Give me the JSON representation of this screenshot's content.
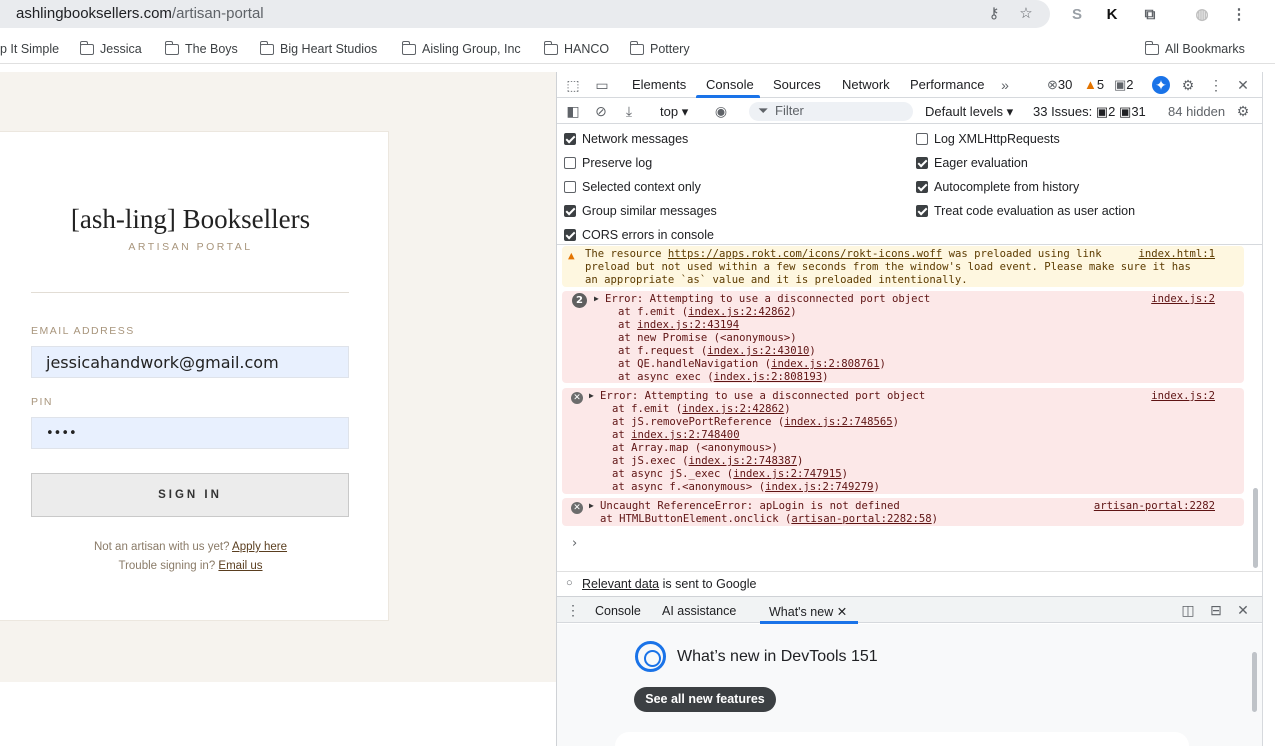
{
  "browser": {
    "url_host": "ashlingbooksellers.com",
    "url_path": "/artisan-portal",
    "bookmarks": [
      "p It Simple",
      "Jessica",
      "The Boys",
      "Big Heart Studios",
      "Aisling Group, Inc",
      "HANCO",
      "Pottery"
    ],
    "all_bookmarks": "All Bookmarks",
    "extensions": [
      "S",
      "K"
    ]
  },
  "login": {
    "brand": "[ash-ling] Booksellers",
    "subbrand": "ARTISAN PORTAL",
    "email_label": "EMAIL ADDRESS",
    "email_value": "jessicahandwork@gmail.com",
    "pin_label": "PIN",
    "pin_value": "••••",
    "signin_label": "SIGN IN",
    "not_artisan": "Not an artisan with us yet?",
    "apply_link": "Apply here",
    "trouble": "Trouble signing in?",
    "email_link": "Email us"
  },
  "devtools": {
    "tabs": [
      "Elements",
      "Console",
      "Sources",
      "Network",
      "Performance"
    ],
    "active_tab": "Console",
    "errors_count": "30",
    "warnings_count": "5",
    "info_count": "2",
    "context": "top",
    "filter_placeholder": "Filter",
    "levels": "Default levels",
    "issues_label": "33 Issues:",
    "issues_a": "2",
    "issues_b": "31",
    "hidden": "84 hidden",
    "settings": {
      "left": [
        {
          "label": "Network messages",
          "checked": true
        },
        {
          "label": "Preserve log",
          "checked": false
        },
        {
          "label": "Selected context only",
          "checked": false
        },
        {
          "label": "Group similar messages",
          "checked": true
        },
        {
          "label": "CORS errors in console",
          "checked": true
        }
      ],
      "right": [
        {
          "label": "Log XMLHttpRequests",
          "checked": false
        },
        {
          "label": "Eager evaluation",
          "checked": true
        },
        {
          "label": "Autocomplete from history",
          "checked": true
        },
        {
          "label": "Treat code evaluation as user action",
          "checked": true
        }
      ]
    },
    "warning": {
      "prefix": "The resource ",
      "link": "https://apps.rokt.com/icons/rokt-icons.woff",
      "rest1": " was preloaded using link",
      "line2": "preload but not used within a few seconds from the window's load event. Please make sure it has",
      "line3": "an appropriate `as` value and it is preloaded intentionally.",
      "source": "index.html:1"
    },
    "error1": {
      "count": "2",
      "title": "Error: Attempting to use a disconnected port object",
      "source": "index.js:2",
      "stack": [
        [
          "at f.emit (",
          "index.js:2:42862",
          ")"
        ],
        [
          "at ",
          "index.js:2:43194",
          ""
        ],
        [
          "at new Promise (<anonymous>)",
          "",
          ""
        ],
        [
          "at f.request (",
          "index.js:2:43010",
          ")"
        ],
        [
          "at QE.handleNavigation (",
          "index.js:2:808761",
          ")"
        ],
        [
          "at async exec (",
          "index.js:2:808193",
          ")"
        ]
      ]
    },
    "error2": {
      "title": "Error: Attempting to use a disconnected port object",
      "source": "index.js:2",
      "stack": [
        [
          "at f.emit (",
          "index.js:2:42862",
          ")"
        ],
        [
          "at jS.removePortReference (",
          "index.js:2:748565",
          ")"
        ],
        [
          "at ",
          "index.js:2:748400",
          ""
        ],
        [
          "at Array.map (<anonymous>)",
          "",
          ""
        ],
        [
          "at jS.exec (",
          "index.js:2:748387",
          ")"
        ],
        [
          "at async jS._exec (",
          "index.js:2:747915",
          ")"
        ],
        [
          "at async f.<anonymous> (",
          "index.js:2:749279",
          ")"
        ]
      ]
    },
    "error3": {
      "title": "Uncaught ReferenceError: apLogin is not defined",
      "source": "artisan-portal:2282",
      "stack_prefix": "at HTMLButtonElement.onclick (",
      "stack_link": "artisan-portal:2282:58",
      "stack_suffix": ")"
    },
    "relevant_link": "Relevant data",
    "relevant_rest": " is sent to Google",
    "drawer_tabs": [
      "Console",
      "AI assistance",
      "What's new"
    ],
    "whats_new_title": "What’s new in DevTools 151",
    "whats_new_button": "See all new features"
  }
}
